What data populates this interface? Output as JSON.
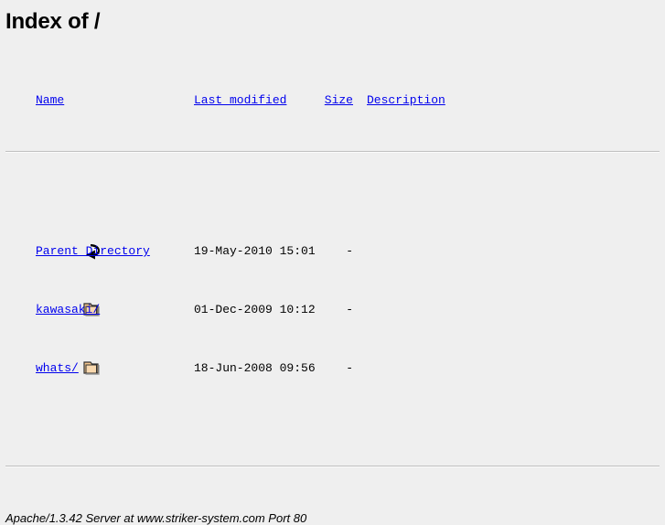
{
  "page": {
    "title": "Index of /"
  },
  "table": {
    "headers": {
      "name": "Name",
      "last_modified": "Last modified",
      "size": "Size",
      "description": "Description"
    },
    "rows": [
      {
        "icon": "back-arrow-icon",
        "name": "Parent Directory",
        "last_modified": "19-May-2010 15:01",
        "size": "-",
        "description": ""
      },
      {
        "icon": "folder-icon",
        "name": "kawasaki/",
        "last_modified": "01-Dec-2009 10:12",
        "size": "-",
        "description": ""
      },
      {
        "icon": "folder-icon",
        "name": "whats/",
        "last_modified": "18-Jun-2008 09:56",
        "size": "-",
        "description": ""
      }
    ]
  },
  "footer": {
    "text": "Apache/1.3.42 Server at www.striker-system.com Port 80"
  },
  "colors": {
    "background": "#efefef",
    "link": "#0000ee",
    "text": "#000000",
    "rule": "#bfbfbf",
    "folder_body": "#f5c78e",
    "folder_outline": "#303030"
  }
}
